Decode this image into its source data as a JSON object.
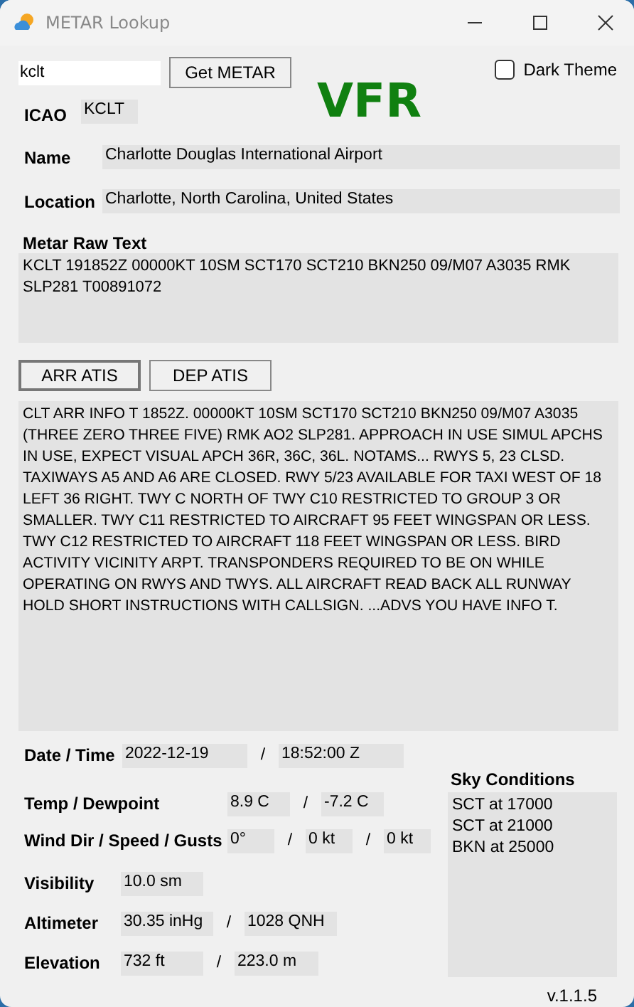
{
  "window": {
    "title": "METAR Lookup"
  },
  "search": {
    "value": "kclt",
    "button": "Get METAR"
  },
  "dark_theme": {
    "label": "Dark Theme",
    "checked": false
  },
  "flight_category": {
    "text": "VFR",
    "kind": "vfr"
  },
  "station": [
    {
      "label": "ICAO",
      "value": "KCLT"
    },
    {
      "label": "Name",
      "value": "Charlotte Douglas International Airport"
    },
    {
      "label": "Location",
      "value": "Charlotte, North Carolina, United States"
    }
  ],
  "metar_raw": {
    "label": "Metar Raw Text",
    "value": "KCLT 191852Z 00000KT 10SM SCT170 SCT210 BKN250 09/M07 A3035 RMK SLP281 T00891072"
  },
  "atis_tabs": [
    {
      "label": "ARR ATIS",
      "selected": true
    },
    {
      "label": "DEP ATIS",
      "selected": false
    }
  ],
  "atis_text": "CLT ARR INFO T 1852Z. 00000KT 10SM SCT170 SCT210 BKN250 09/M07 A3035 (THREE ZERO THREE FIVE) RMK AO2 SLP281. APPROACH IN USE SIMUL APCHS IN USE, EXPECT VISUAL APCH 36R, 36C, 36L. NOTAMS... RWYS 5, 23 CLSD. TAXIWAYS A5 AND A6 ARE CLOSED. RWY 5/23 AVAILABLE FOR TAXI WEST OF 18 LEFT 36 RIGHT. TWY C NORTH OF TWY C10 RESTRICTED TO GROUP 3 OR SMALLER. TWY C11 RESTRICTED TO AIRCRAFT 95 FEET WINGSPAN OR LESS. TWY C12 RESTRICTED TO AIRCRAFT 118 FEET WINGSPAN OR LESS. BIRD ACTIVITY VICINITY ARPT. TRANSPONDERS REQUIRED TO BE ON WHILE OPERATING ON RWYS AND TWYS. ALL AIRCRAFT READ BACK ALL RUNWAY HOLD SHORT INSTRUCTIONS WITH CALLSIGN. ...ADVS YOU HAVE INFO T.",
  "observations": [
    {
      "label": "Date / Time",
      "separator": "/",
      "values": [
        "2022-12-19",
        "18:52:00 Z"
      ]
    },
    {
      "label": "Temp / Dewpoint",
      "separator": "/",
      "values": [
        "8.9 C",
        "-7.2 C"
      ]
    },
    {
      "label": "Wind Dir / Speed / Gusts",
      "separator": "/",
      "values": [
        "0°",
        "0 kt",
        "0 kt"
      ]
    },
    {
      "label": "Visibility",
      "values": [
        "10.0 sm"
      ]
    },
    {
      "label": "Altimeter",
      "separator": "/",
      "values": [
        "30.35 inHg",
        "1028 QNH"
      ]
    },
    {
      "label": "Elevation",
      "separator": "/",
      "values": [
        "732 ft",
        "223.0 m"
      ]
    }
  ],
  "sky": {
    "label": "Sky Conditions",
    "layers": [
      "SCT at 17000",
      "SCT at 21000",
      "BKN at 25000"
    ]
  },
  "version": "v.1.1.5"
}
